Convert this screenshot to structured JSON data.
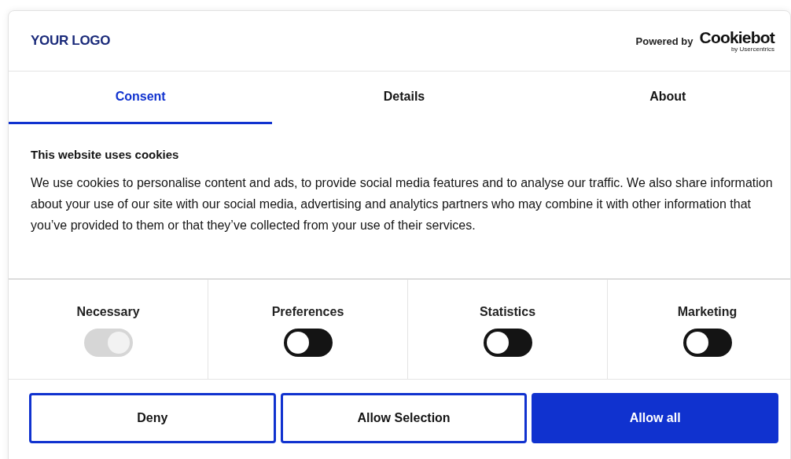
{
  "header": {
    "logo": "YOUR LOGO",
    "powered_by": "Powered by",
    "brand": "Cookiebot",
    "brand_sub": "by Usercentrics"
  },
  "tabs": [
    {
      "label": "Consent",
      "selected": true
    },
    {
      "label": "Details",
      "selected": false
    },
    {
      "label": "About",
      "selected": false
    }
  ],
  "body": {
    "title": "This website uses cookies",
    "text": "We use cookies to personalise content and ads, to provide social media features and to analyse our traffic. We also share information about your use of our site with our social media, advertising and analytics partners who may combine it with other information that you’ve provided to them or that they’ve collected from your use of their services."
  },
  "categories": [
    {
      "label": "Necessary",
      "on": true,
      "disabled": true
    },
    {
      "label": "Preferences",
      "on": false,
      "disabled": false
    },
    {
      "label": "Statistics",
      "on": false,
      "disabled": false
    },
    {
      "label": "Marketing",
      "on": false,
      "disabled": false
    }
  ],
  "buttons": [
    {
      "label": "Deny",
      "kind": "outline"
    },
    {
      "label": "Allow Selection",
      "kind": "outline"
    },
    {
      "label": "Allow all",
      "kind": "filled"
    }
  ]
}
